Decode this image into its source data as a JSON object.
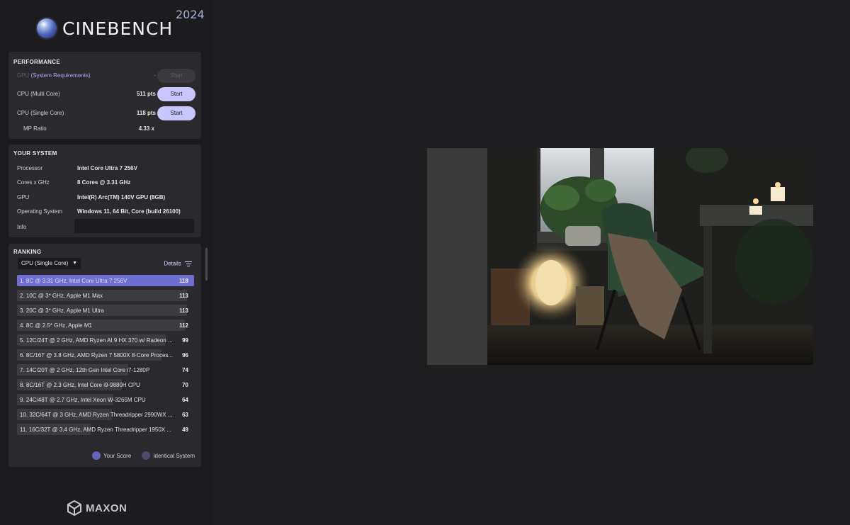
{
  "app": {
    "name": "CINEBENCH",
    "year": "2024",
    "vendor": "MAXON"
  },
  "performance": {
    "title": "PERFORMANCE",
    "gpu": {
      "label": "GPU",
      "link": "(System Requirements)",
      "value": "-",
      "button": "Start"
    },
    "cpu_multi": {
      "label": "CPU (Multi Core)",
      "value": "511 pts",
      "button": "Start"
    },
    "cpu_single": {
      "label": "CPU (Single Core)",
      "value": "118 pts",
      "button": "Start"
    },
    "mp_ratio": {
      "label": "MP Ratio",
      "value": "4.33 x"
    }
  },
  "system": {
    "title": "YOUR SYSTEM",
    "rows": [
      {
        "key": "Processor",
        "value": "Intel Core Ultra 7 256V"
      },
      {
        "key": "Cores x GHz",
        "value": "8 Cores @ 3.31 GHz"
      },
      {
        "key": "GPU",
        "value": "Intel(R) Arc(TM) 140V GPU (8GB)"
      },
      {
        "key": "Operating System",
        "value": "Windows 11, 64 Bit, Core (build 26100)"
      },
      {
        "key": "Info",
        "value": ""
      }
    ]
  },
  "ranking": {
    "title": "RANKING",
    "selected": "CPU (Single Core)",
    "details_label": "Details",
    "items": [
      {
        "label": "1. 8C @ 3.31 GHz, Intel Core Ultra 7 256V",
        "score": "118",
        "fraction": 1.0,
        "you": true
      },
      {
        "label": "2. 10C @ 3* GHz, Apple M1 Max",
        "score": "113",
        "fraction": 0.958,
        "you": false
      },
      {
        "label": "3. 20C @ 3* GHz, Apple M1 Ultra",
        "score": "113",
        "fraction": 0.958,
        "you": false
      },
      {
        "label": "4. 8C @ 2.5* GHz, Apple M1",
        "score": "112",
        "fraction": 0.949,
        "you": false
      },
      {
        "label": "5. 12C/24T @ 2 GHz, AMD Ryzen AI 9 HX 370 w/ Radeon ...",
        "score": "99",
        "fraction": 0.839,
        "you": false
      },
      {
        "label": "6. 8C/16T @ 3.8 GHz, AMD Ryzen 7 5800X 8-Core Proces...",
        "score": "96",
        "fraction": 0.814,
        "you": false
      },
      {
        "label": "7. 14C/20T @ 2 GHz, 12th Gen Intel Core i7-1280P",
        "score": "74",
        "fraction": 0.627,
        "you": false
      },
      {
        "label": "8. 8C/16T @ 2.3 GHz, Intel Core i9-9880H CPU",
        "score": "70",
        "fraction": 0.593,
        "you": false
      },
      {
        "label": "9. 24C/48T @ 2.7 GHz, Intel Xeon W-3265M CPU",
        "score": "64",
        "fraction": 0.542,
        "you": false
      },
      {
        "label": "10. 32C/64T @ 3 GHz, AMD Ryzen Threadripper 2990WX ...",
        "score": "63",
        "fraction": 0.534,
        "you": false
      },
      {
        "label": "11. 16C/32T @ 3.4 GHz, AMD Ryzen Threadripper 1950X ...",
        "score": "49",
        "fraction": 0.415,
        "you": false
      }
    ],
    "legend": {
      "your_score": "Your Score",
      "identical_system": "Identical System"
    }
  },
  "colors": {
    "accent": "#c8c6fb",
    "your_bar": "#6f6ed0",
    "bar": "#3b3b40",
    "background": "#1e1e21",
    "panel": "#2a2a2e"
  }
}
